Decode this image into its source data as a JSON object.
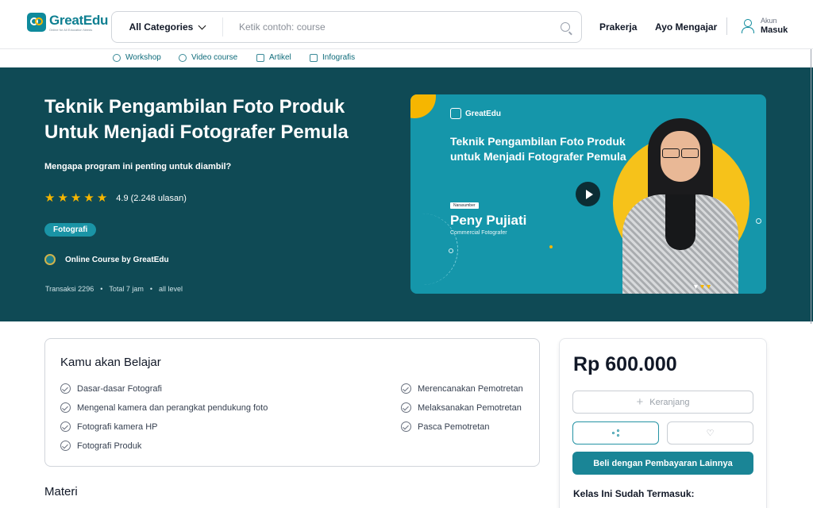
{
  "header": {
    "logo_name": "GreatEdu",
    "logo_tagline": "Online for All Education Needs",
    "category_label": "All Categories",
    "search_placeholder": "Ketik contoh: course",
    "nav": [
      "Prakerja",
      "Ayo Mengajar"
    ],
    "account_small": "Akun",
    "account_main": "Masuk"
  },
  "subnav": [
    "Workshop",
    "Video course",
    "Artikel",
    "Infografis"
  ],
  "hero": {
    "title": "Teknik Pengambilan Foto Produk Untuk Menjadi Fotografer Pemula",
    "subtitle": "Mengapa program ini penting untuk diambil?",
    "rating": "4.9",
    "reviews": "(2.248 ulasan)",
    "stars": 5,
    "tag": "Fotografi",
    "provider": "Online Course by GreatEdu",
    "meta": [
      "Transaksi 2296",
      "Total 7 jam",
      "all level"
    ]
  },
  "thumbnail": {
    "logo": "GreatEdu",
    "title": "Teknik Pengambilan Foto Produk untuk Menjadi Fotografer Pemula",
    "badge": "Narasumber",
    "speaker": "Peny Pujiati",
    "role": "Commercial Fotografer"
  },
  "learn": {
    "title": "Kamu akan Belajar",
    "left": [
      "Dasar-dasar Fotografi",
      "Mengenal kamera dan perangkat pendukung foto",
      "Fotografi kamera HP",
      "Fotografi Produk"
    ],
    "right": [
      "Merencanakan Pemotretan",
      "Melaksanakan Pemotretan",
      "Pasca Pemotretan"
    ]
  },
  "materi_title": "Materi",
  "purchase": {
    "price": "Rp 600.000",
    "cart_label": "Keranjang",
    "buy_label": "Beli dengan Pembayaran Lainnya",
    "includes_title": "Kelas Ini Sudah Termasuk:"
  },
  "colors": {
    "brand": "#0e8a9c",
    "hero_bg": "#0f4a55",
    "accent": "#f6b600",
    "buy_button": "#1a8596"
  }
}
